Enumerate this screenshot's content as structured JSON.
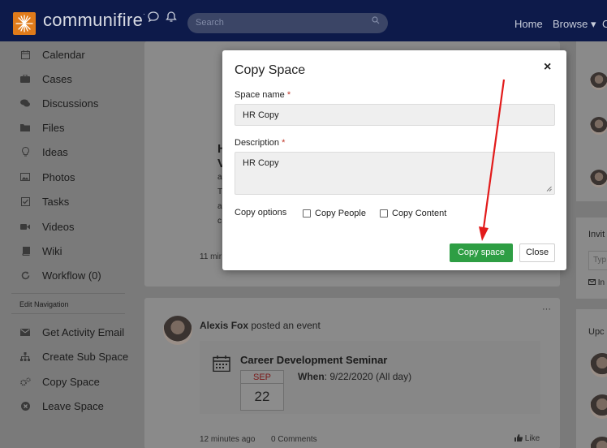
{
  "header": {
    "brand": "communifire",
    "brand_mark": "·",
    "search_placeholder": "Search",
    "nav": [
      "Home",
      "Browse ▾",
      "C"
    ]
  },
  "sidebar": {
    "items": [
      {
        "label": "Calendar",
        "icon": "calendar-icon"
      },
      {
        "label": "Cases",
        "icon": "briefcase-icon"
      },
      {
        "label": "Discussions",
        "icon": "chat-icon"
      },
      {
        "label": "Files",
        "icon": "folder-icon"
      },
      {
        "label": "Ideas",
        "icon": "lightbulb-icon"
      },
      {
        "label": "Photos",
        "icon": "image-icon"
      },
      {
        "label": "Tasks",
        "icon": "checkbox-icon"
      },
      {
        "label": "Videos",
        "icon": "video-icon"
      },
      {
        "label": "Wiki",
        "icon": "book-icon"
      },
      {
        "label": "Workflow (0)",
        "icon": "refresh-icon"
      }
    ],
    "section_caption": "Edit Navigation",
    "actions": [
      {
        "label": "Get Activity Email",
        "icon": "envelope-icon"
      },
      {
        "label": "Create Sub Space",
        "icon": "sitemap-icon"
      },
      {
        "label": "Copy Space",
        "icon": "cogs-icon"
      },
      {
        "label": "Leave Space",
        "icon": "close-circle-icon"
      }
    ]
  },
  "feed": {
    "post_time_1": "11 mir",
    "snippet_letters": [
      "H",
      "V",
      "a",
      "T",
      "a",
      "c"
    ],
    "author": "Alexis Fox",
    "author_action": "posted an event",
    "more": "···",
    "event_title": "Career Development Seminar",
    "event_month": "SEP",
    "event_day": "22",
    "when_label": "When",
    "when_value": ": 9/22/2020 (All day)",
    "post_time_2": "12 minutes ago",
    "comments": "0 Comments",
    "like": "Like"
  },
  "right_column": {
    "invite_title": "Invit",
    "invite_placeholder": "Typ",
    "invite_link": "In",
    "upcoming_title": "Upc"
  },
  "modal": {
    "title": "Copy Space",
    "close": "×",
    "space_name_label": "Space name",
    "space_name_value": "HR Copy",
    "description_label": "Description",
    "description_value": "HR Copy",
    "required_mark": "*",
    "copy_options_label": "Copy options",
    "copy_people_label": "Copy People",
    "copy_content_label": "Copy Content",
    "primary_button": "Copy space",
    "secondary_button": "Close"
  },
  "colors": {
    "topbar": "#0d1a4a",
    "accent_orange": "#e07b1a",
    "primary_green": "#2e9e44",
    "arrow_red": "#e21b1b"
  }
}
